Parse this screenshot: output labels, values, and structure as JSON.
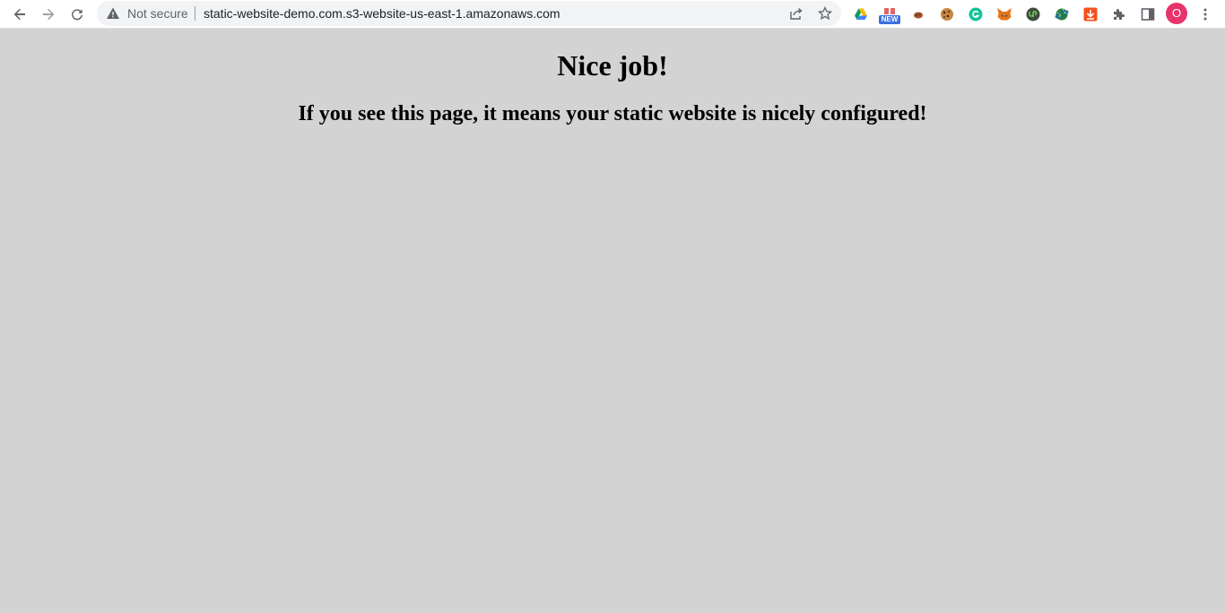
{
  "browser": {
    "security_label": "Not secure",
    "url": "static-website-demo.com.s3-website-us-east-1.amazonaws.com",
    "extensions": [
      {
        "name": "google-drive"
      },
      {
        "name": "new-extension",
        "badge": "NEW"
      },
      {
        "name": "cookie-small"
      },
      {
        "name": "cookie"
      },
      {
        "name": "grammarly"
      },
      {
        "name": "metamask"
      },
      {
        "name": "upwork"
      },
      {
        "name": "globe"
      },
      {
        "name": "download"
      }
    ],
    "profile_initial": "O"
  },
  "page": {
    "heading": "Nice job!",
    "subheading": "If you see this page, it means your static website is nicely configured!"
  },
  "colors": {
    "page_background": "#d3d3d3",
    "avatar": "#e8336d"
  }
}
